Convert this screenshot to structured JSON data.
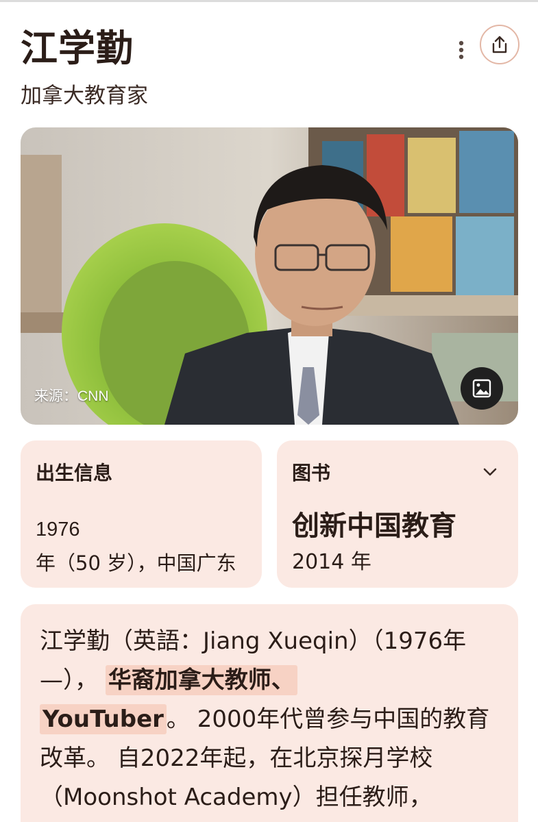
{
  "header": {
    "title": "江学勤",
    "subtitle": "加拿大教育家"
  },
  "photo": {
    "source": "来源：CNN"
  },
  "birth_card": {
    "label": "出生信息",
    "year": "1976",
    "detail": "年（50 岁），中国广东"
  },
  "books_card": {
    "label": "图书",
    "book_title": "创新中国教育",
    "book_year": "2014 年"
  },
  "description": {
    "part1": "江学勤（英語：Jiang Xueqin）（1976年—），",
    "highlight1": "华裔加拿大教师、",
    "highlight2": "YouTuber",
    "part2": "。 2000年代曾参与中国的教育改革。 自2022年起，在北京探月学校（Moonshot Academy）担任教师，"
  },
  "icons": {
    "more": "more-vert-icon",
    "share": "share-icon",
    "image": "image-icon",
    "chevron": "chevron-down-icon"
  },
  "colors": {
    "card_bg": "#fbe9e3",
    "highlight": "#f7d2c4",
    "text": "#2b1d18",
    "share_ring": "#e3b7a6"
  }
}
